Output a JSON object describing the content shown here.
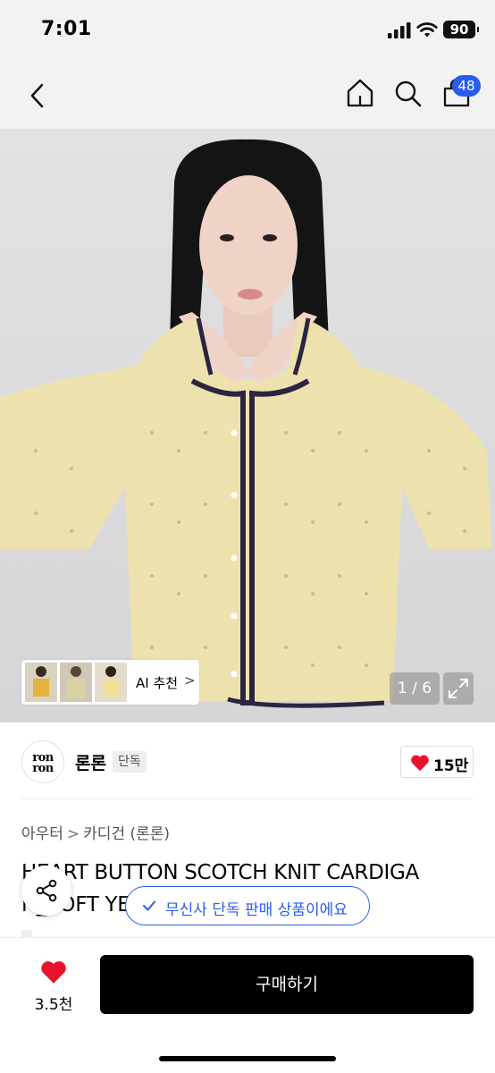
{
  "status_bar": {
    "time": "7:01",
    "battery": "90",
    "icons": [
      "signal-icon",
      "wifi-icon",
      "battery-icon"
    ]
  },
  "nav": {
    "icons": [
      "back-icon",
      "home-icon",
      "search-icon",
      "cart-icon"
    ],
    "cart_badge": "48"
  },
  "gallery": {
    "ai_recommend_label": "AI 추천",
    "ai_recommend_chevron": ">",
    "counter": "1 / 6",
    "icons": [
      "expand-icon"
    ]
  },
  "brand": {
    "logo_line1": "ron",
    "logo_line2": "ron",
    "name": "론론",
    "tag": "단독",
    "like_count": "15만"
  },
  "product": {
    "breadcrumb": [
      "아우터",
      "카디건",
      "(론론)"
    ],
    "breadcrumb_separator": ">",
    "title_line1": "HEART BUTTON SCOTCH KNIT CARDIGA",
    "title_line2": "N_SOFT YELLOW"
  },
  "toast": {
    "text": "무신사 단독 판매 상품이에요"
  },
  "bottom_bar": {
    "wish_count": "3.5천",
    "buy_label": "구매하기"
  },
  "colors": {
    "accent_blue": "#2a5cf0",
    "heart_red": "#e8132b",
    "buy_button": "#000000"
  }
}
